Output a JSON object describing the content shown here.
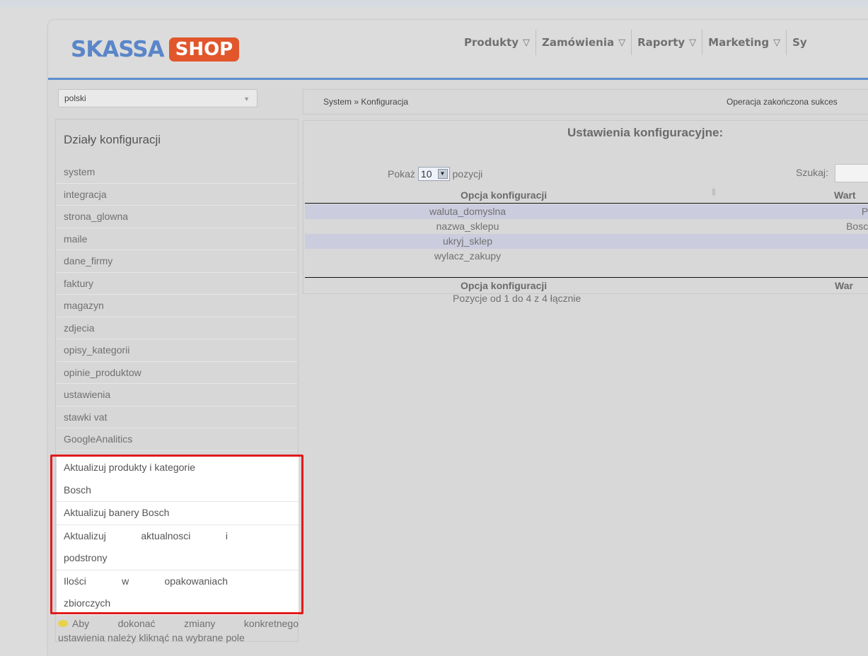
{
  "logo": {
    "part1": "SKASSA",
    "part2": "SHOP"
  },
  "nav": [
    {
      "label": "Produkty"
    },
    {
      "label": "Zamówienia"
    },
    {
      "label": "Raporty"
    },
    {
      "label": "Marketing"
    },
    {
      "label": "Sy"
    }
  ],
  "language": {
    "selected": "polski"
  },
  "sidebar": {
    "title": "Działy konfiguracji",
    "items": [
      "system",
      "integracja",
      "strona_glowna",
      "maile",
      "dane_firmy",
      "faktury",
      "magazyn",
      "zdjecia",
      "opisy_kategorii",
      "opinie_produktow",
      "ustawienia",
      "stawki vat",
      "GoogleAnalitics"
    ],
    "highlighted": {
      "item1_line1": "Aktualizuj produkty i kategorie",
      "item1_line2": "Bosch",
      "item2": "Aktualizuj banery Bosch",
      "item3_line1_a": "Aktualizuj",
      "item3_line1_b": "aktualnosci",
      "item3_line1_c": "i",
      "item3_line2": "podstrony",
      "item4_line1_a": "Ilości",
      "item4_line1_b": "w",
      "item4_line1_c": "opakowaniach",
      "item4_line2": "zbiorczych"
    },
    "hint_line1_words": [
      "Aby",
      "dokonać",
      "zmiany",
      "konkretnego"
    ],
    "hint_line2": "ustawienia należy kliknąć na wybrane pole"
  },
  "breadcrumb": "System » Konfiguracja",
  "status": "Operacja zakończona sukces",
  "panel": {
    "title": "Ustawienia konfiguracyjne:",
    "show_label": "Pokaż",
    "show_value": "10",
    "show_suffix": "pozycji",
    "search_label": "Szukaj:",
    "col_option": "Opcja konfiguracji",
    "col_value": "Wart",
    "col_value_footer": "War",
    "rows": [
      {
        "option": "waluta_domyslna",
        "value": "PL"
      },
      {
        "option": "nazwa_sklepu",
        "value": "Bosch"
      },
      {
        "option": "ukryj_sklep",
        "value": "("
      },
      {
        "option": "wylacz_zakupy",
        "value": "("
      }
    ],
    "info": "Pozycje od 1 do 4 z 4 łącznie"
  }
}
